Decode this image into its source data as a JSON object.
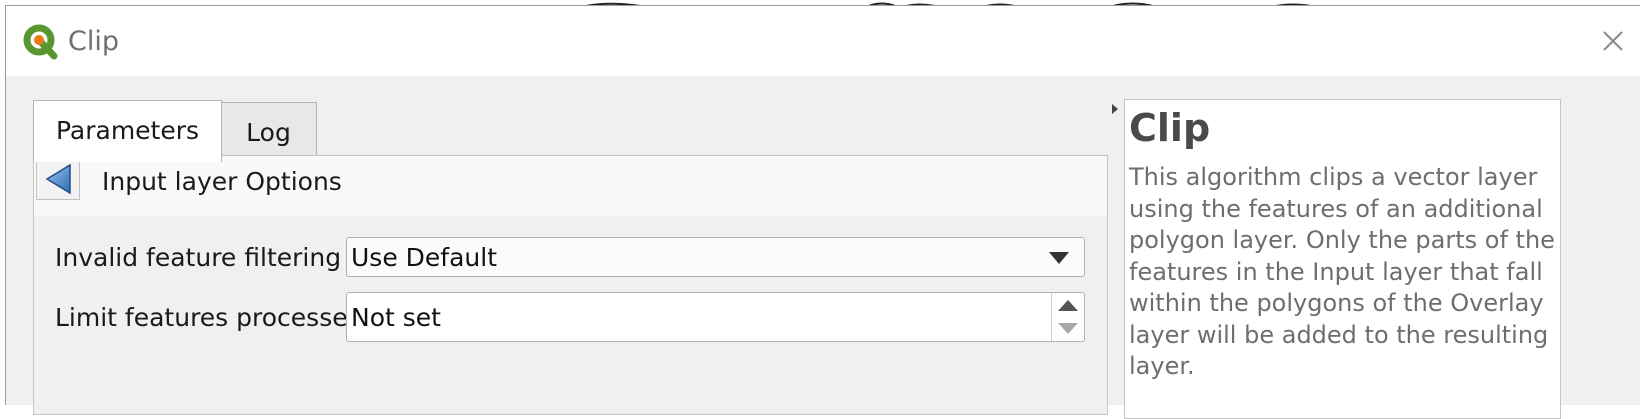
{
  "window": {
    "title": "Clip"
  },
  "tabs": [
    {
      "label": "Parameters",
      "active": true
    },
    {
      "label": "Log",
      "active": false
    }
  ],
  "options": {
    "title": "Input layer Options",
    "fields": [
      {
        "label": "Invalid feature filtering",
        "value": "Use Default",
        "type": "combo"
      },
      {
        "label": "Limit features processed",
        "value": "Not set",
        "type": "spinbox"
      }
    ]
  },
  "help": {
    "title": "Clip",
    "body": "This algorithm clips a vector layer using the features of an additional polygon layer. Only the parts of the features in the Input layer that fall within the polygons of the Overlay layer will be added to the resulting layer."
  },
  "icons": {
    "app": "qgis-logo-icon",
    "close": "close-icon",
    "back": "back-arrow-icon",
    "combo": "chevron-down-icon",
    "spin_up": "arrow-up-icon",
    "spin_down": "arrow-down-icon"
  },
  "colors": {
    "qgis_green": "#589632",
    "qgis_yellow": "#ee7913",
    "back_arrow": "#3d7fc4"
  }
}
